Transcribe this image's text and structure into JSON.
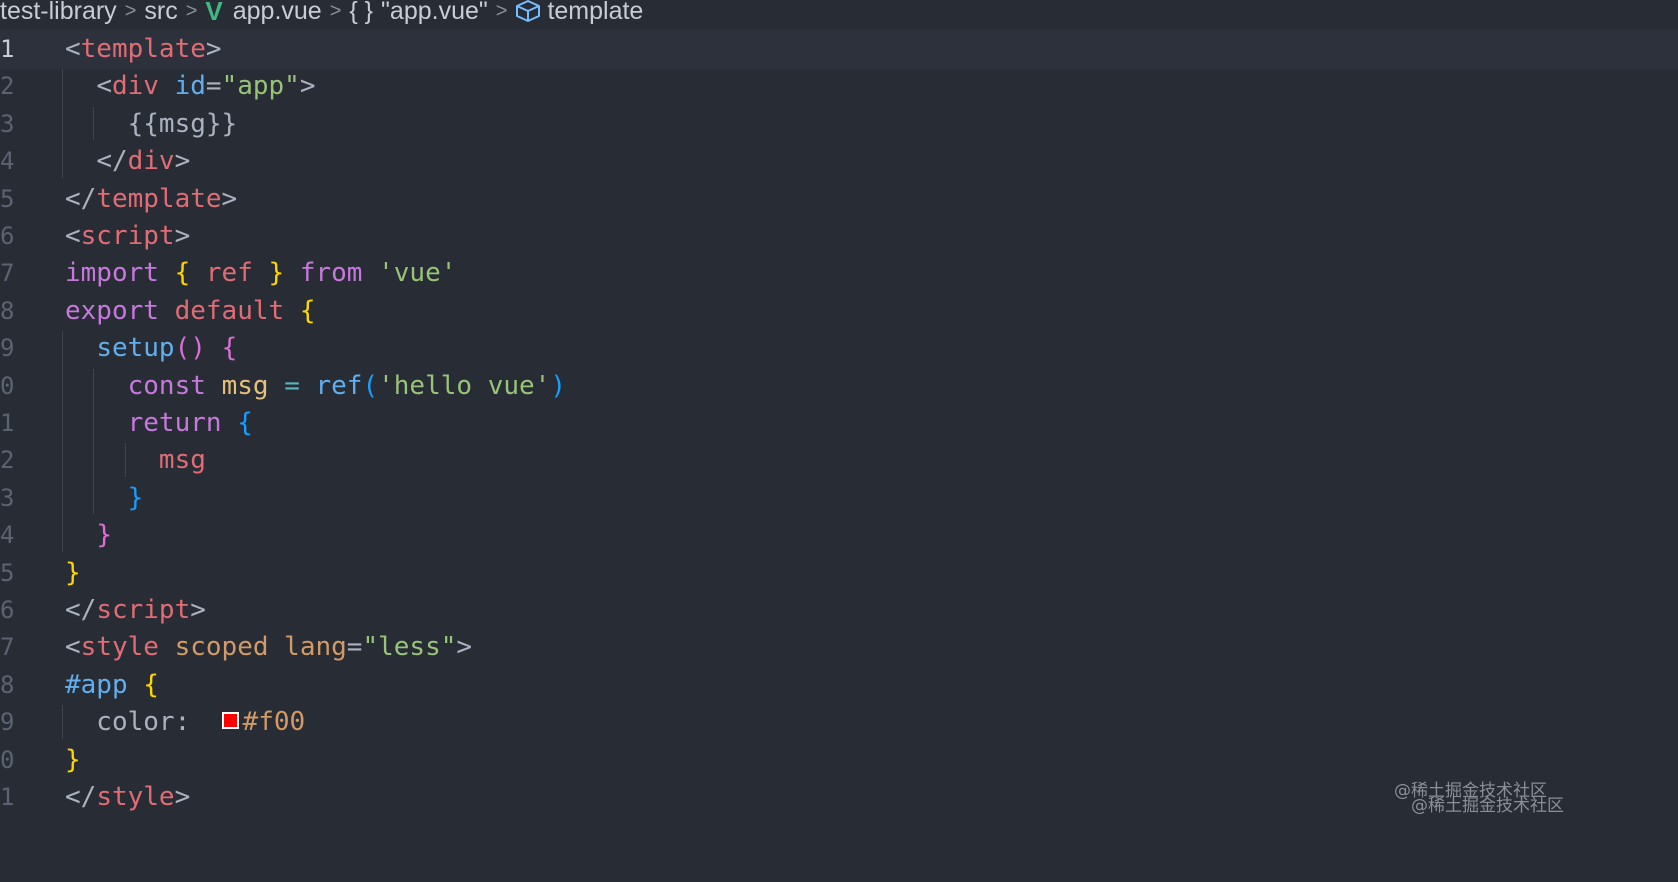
{
  "breadcrumb": {
    "items": [
      "test-library",
      "src",
      "app.vue",
      "\"app.vue\"",
      "template"
    ],
    "separator": ">",
    "icons": {
      "vue": "vue-logo-icon",
      "object": "braces-icon",
      "template": "cube-icon"
    },
    "braces_glyph": "{ }"
  },
  "editor": {
    "current_line": 1,
    "line_numbers": [
      "1",
      "2",
      "3",
      "4",
      "5",
      "6",
      "7",
      "8",
      "9",
      "0",
      "1",
      "2",
      "3",
      "4",
      "5",
      "6",
      "7",
      "8",
      "9",
      "0",
      "1"
    ],
    "lines": [
      [
        [
          "c-punct",
          "<"
        ],
        [
          "c-tag",
          "template"
        ],
        [
          "c-punct",
          ">"
        ]
      ],
      [
        [
          "c-plain",
          "  "
        ],
        [
          "c-punct",
          "<"
        ],
        [
          "c-tag",
          "div"
        ],
        [
          "c-plain",
          " "
        ],
        [
          "c-attr",
          "id"
        ],
        [
          "c-punct",
          "="
        ],
        [
          "c-str",
          "\"app\""
        ],
        [
          "c-punct",
          ">"
        ]
      ],
      [
        [
          "c-plain",
          "    {{msg}}"
        ]
      ],
      [
        [
          "c-plain",
          "  "
        ],
        [
          "c-punct",
          "</"
        ],
        [
          "c-tag",
          "div"
        ],
        [
          "c-punct",
          ">"
        ]
      ],
      [
        [
          "c-punct",
          "</"
        ],
        [
          "c-tag",
          "template"
        ],
        [
          "c-punct",
          ">"
        ]
      ],
      [
        [
          "c-punct",
          "<"
        ],
        [
          "c-tag",
          "script"
        ],
        [
          "c-punct",
          ">"
        ]
      ],
      [
        [
          "c-kw",
          "import"
        ],
        [
          "c-plain",
          " "
        ],
        [
          "c-brace1",
          "{"
        ],
        [
          "c-plain",
          " "
        ],
        [
          "c-prop",
          "ref"
        ],
        [
          "c-plain",
          " "
        ],
        [
          "c-brace1",
          "}"
        ],
        [
          "c-plain",
          " "
        ],
        [
          "c-kw",
          "from"
        ],
        [
          "c-plain",
          " "
        ],
        [
          "c-str",
          "'vue'"
        ]
      ],
      [
        [
          "c-kw",
          "export"
        ],
        [
          "c-plain",
          " "
        ],
        [
          "c-prop",
          "default"
        ],
        [
          "c-plain",
          " "
        ],
        [
          "c-brace1",
          "{"
        ]
      ],
      [
        [
          "c-plain",
          "  "
        ],
        [
          "c-fn",
          "setup"
        ],
        [
          "c-brace2",
          "()"
        ],
        [
          "c-plain",
          " "
        ],
        [
          "c-brace2",
          "{"
        ]
      ],
      [
        [
          "c-plain",
          "    "
        ],
        [
          "c-kw",
          "const"
        ],
        [
          "c-plain",
          " "
        ],
        [
          "c-var",
          "msg"
        ],
        [
          "c-plain",
          " "
        ],
        [
          "c-op",
          "="
        ],
        [
          "c-plain",
          " "
        ],
        [
          "c-fn",
          "ref"
        ],
        [
          "c-brace3",
          "("
        ],
        [
          "c-str",
          "'hello vue'"
        ],
        [
          "c-brace3",
          ")"
        ]
      ],
      [
        [
          "c-plain",
          "    "
        ],
        [
          "c-kw",
          "return"
        ],
        [
          "c-plain",
          " "
        ],
        [
          "c-brace3",
          "{"
        ]
      ],
      [
        [
          "c-plain",
          "      "
        ],
        [
          "c-prop",
          "msg"
        ]
      ],
      [
        [
          "c-plain",
          "    "
        ],
        [
          "c-brace3",
          "}"
        ]
      ],
      [
        [
          "c-plain",
          "  "
        ],
        [
          "c-brace2",
          "}"
        ]
      ],
      [
        [
          "c-brace1",
          "}"
        ]
      ],
      [
        [
          "c-punct",
          "</"
        ],
        [
          "c-tag",
          "script"
        ],
        [
          "c-punct",
          ">"
        ]
      ],
      [
        [
          "c-punct",
          "<"
        ],
        [
          "c-tag",
          "style"
        ],
        [
          "c-plain",
          " "
        ],
        [
          "c-attr2",
          "scoped"
        ],
        [
          "c-plain",
          " "
        ],
        [
          "c-attr2",
          "lang"
        ],
        [
          "c-punct",
          "="
        ],
        [
          "c-str",
          "\"less\""
        ],
        [
          "c-punct",
          ">"
        ]
      ],
      [
        [
          "c-sel",
          "#app"
        ],
        [
          "c-plain",
          " "
        ],
        [
          "c-brace1",
          "{"
        ]
      ],
      [
        [
          "c-plain",
          "  color:  "
        ],
        [
          "swatch",
          "#ff0000"
        ],
        [
          "c-num",
          "#f00"
        ]
      ],
      [
        [
          "c-brace1",
          "}"
        ]
      ],
      [
        [
          "c-punct",
          "</"
        ],
        [
          "c-tag",
          "style"
        ],
        [
          "c-punct",
          ">"
        ]
      ]
    ]
  },
  "watermarks": [
    "@稀土掘金技术社区",
    "@稀土掘金技术社区"
  ],
  "colors": {
    "background": "#282c34",
    "current_line": "#2c313c",
    "swatch": "#ff0000"
  }
}
